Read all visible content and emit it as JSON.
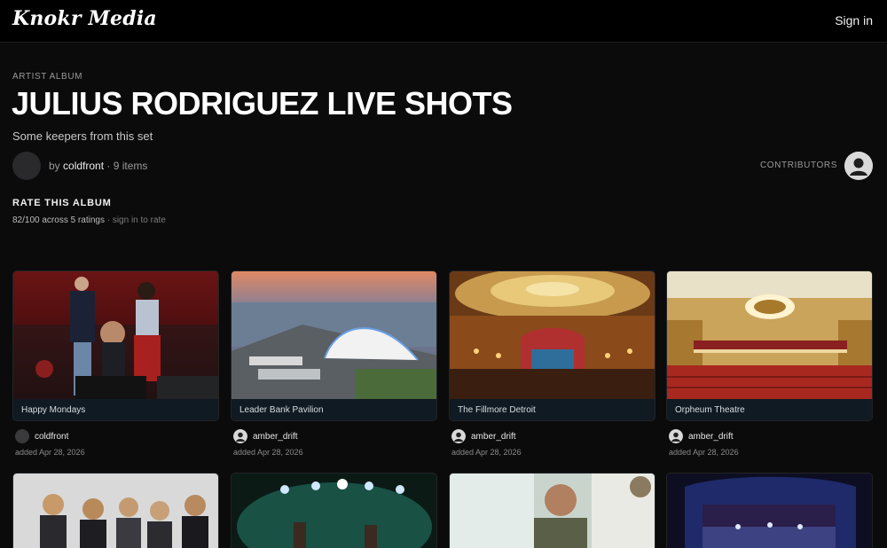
{
  "header": {
    "logo": "Knokr Media",
    "sign_in": "Sign in"
  },
  "album": {
    "eyebrow": "ARTIST ALBUM",
    "title": "JULIUS RODRIGUEZ LIVE SHOTS",
    "subtitle": "Some keepers from this set",
    "by_prefix": "by ",
    "owner": "coldfront",
    "items": " · 9 items",
    "contributors_label": "CONTRIBUTORS"
  },
  "rating": {
    "heading": "RATE THIS ALBUM",
    "summary": "82/100 across 5 ratings",
    "hint": " · sign in to rate"
  },
  "cards": [
    {
      "caption": "Happy Mondays",
      "user": "coldfront",
      "added": "added Apr 28, 2026"
    },
    {
      "caption": "Leader Bank Pavilion",
      "user": "amber_drift",
      "added": "added Apr 28, 2026"
    },
    {
      "caption": "The Fillmore Detroit",
      "user": "amber_drift",
      "added": "added Apr 28, 2026"
    },
    {
      "caption": "Orpheum Theatre",
      "user": "amber_drift",
      "added": "added Apr 28, 2026"
    }
  ]
}
